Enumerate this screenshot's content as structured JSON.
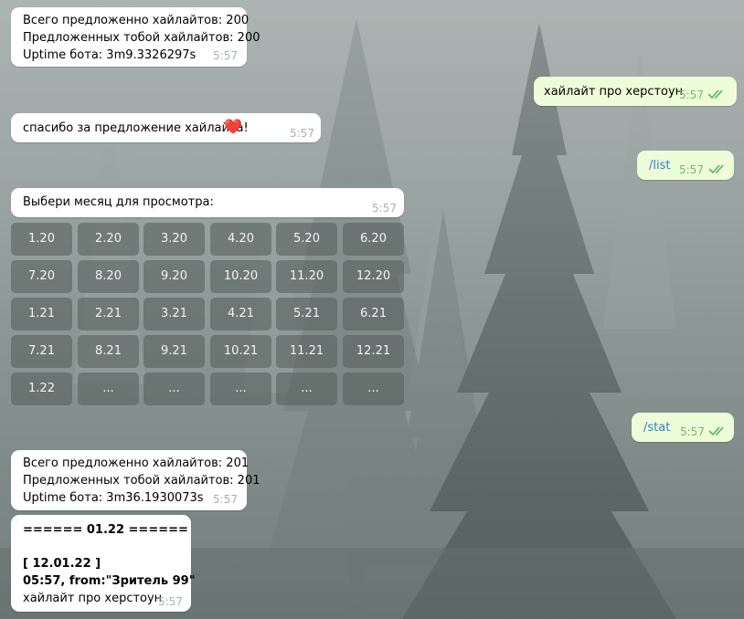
{
  "messages": {
    "stats1": {
      "line1": "Всего предложенно хайлайтов: 200",
      "line2": "Предложенных тобой хайлайтов: 200",
      "line3": "Uptime бота: 3m9.3326297s",
      "time": "5:57"
    },
    "out1": {
      "text": "хайлайт про херстоун",
      "time": "5:57"
    },
    "thanks": {
      "text": "спасибо за предложение хайлайта!",
      "emoji": "❤️",
      "time": "5:57"
    },
    "out_list": {
      "text": "/list",
      "time": "5:57"
    },
    "choose_month": {
      "text": "Выбери месяц для просмотра:",
      "time": "5:57"
    },
    "out_stat": {
      "text": "/stat",
      "time": "5:57"
    },
    "stats2": {
      "line1": "Всего предложенно хайлайтов: 201",
      "line2": "Предложенных тобой хайлайтов: 201",
      "line3": "Uptime бота: 3m36.1930073s",
      "time": "5:57"
    },
    "list_result": {
      "header": "====== 01.22 ======",
      "date": "[ 12.01.22 ]",
      "meta": "05:57, from:\"Зритель 99\"",
      "text": "хайлайт про херстоун",
      "time": "5:57"
    }
  },
  "keyboard": [
    [
      "1.20",
      "2.20",
      "3.20",
      "4.20",
      "5.20",
      "6.20"
    ],
    [
      "7.20",
      "8.20",
      "9.20",
      "10.20",
      "11.20",
      "12.20"
    ],
    [
      "1.21",
      "2.21",
      "3.21",
      "4.21",
      "5.21",
      "6.21"
    ],
    [
      "7.21",
      "8.21",
      "9.21",
      "10.21",
      "11.21",
      "12.21"
    ],
    [
      "1.22",
      "...",
      "...",
      "...",
      "...",
      "..."
    ]
  ],
  "icons": {
    "read_status": "double-check-icon"
  },
  "colors": {
    "incoming_bubble": "#ffffff",
    "outgoing_bubble": "#eefdd9",
    "outgoing_time": "#72b865",
    "command_link": "#2a7fc6",
    "keyboard_button": "#586260"
  }
}
